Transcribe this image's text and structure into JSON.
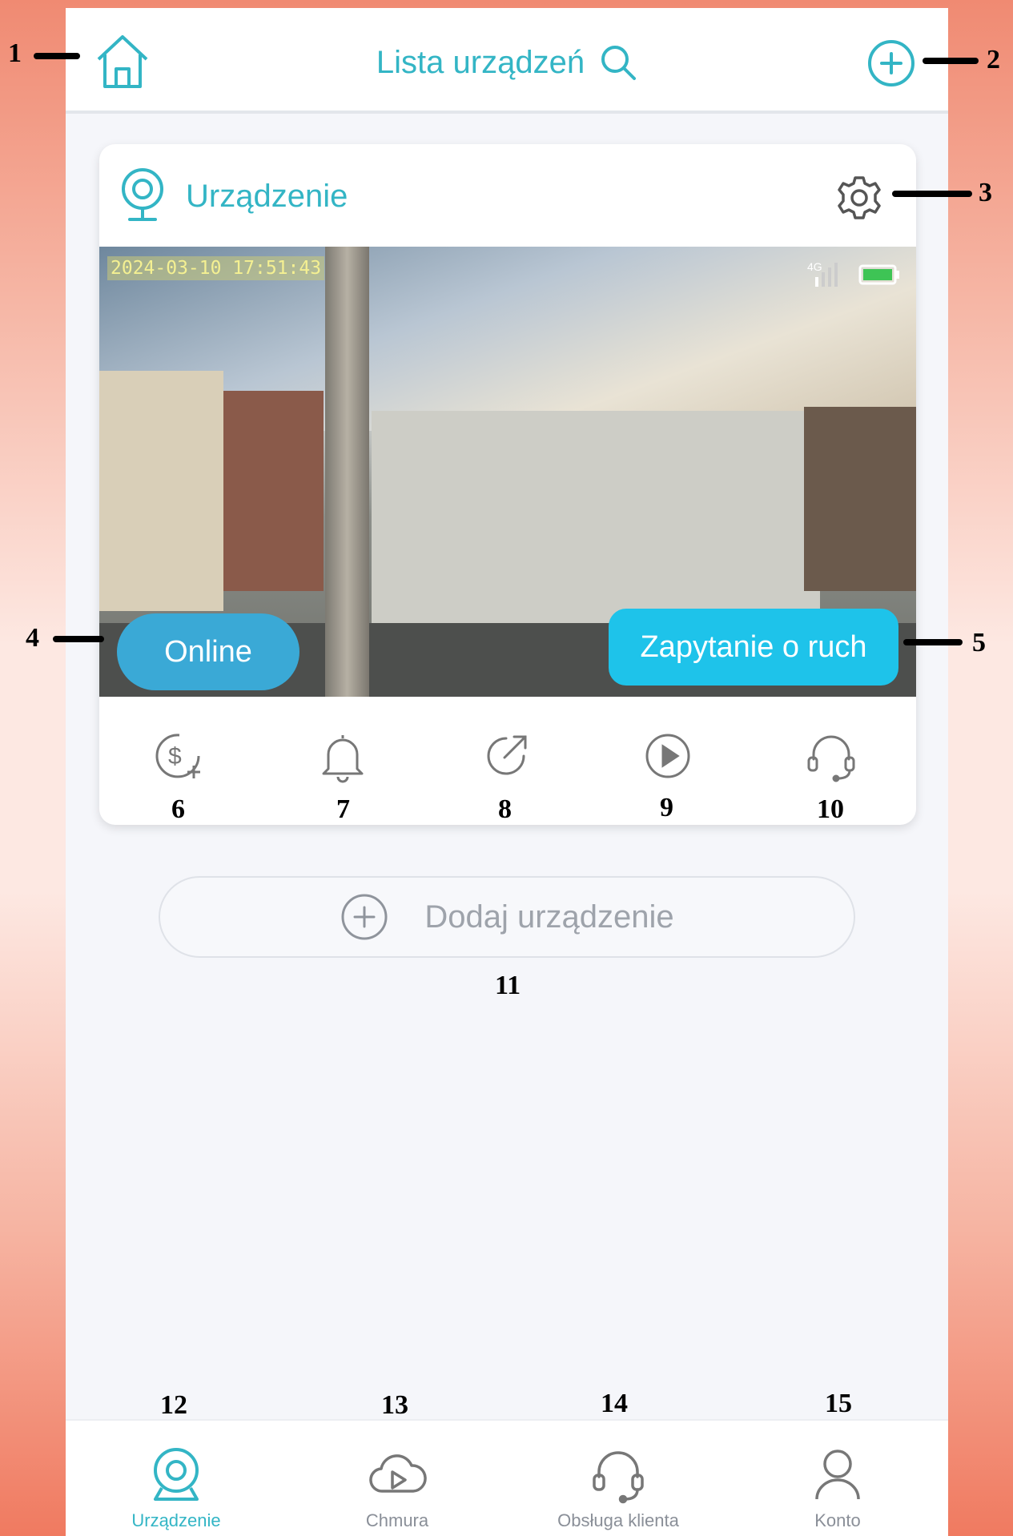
{
  "header": {
    "title": "Lista urządzeń",
    "home_icon": "home-icon",
    "search_icon": "search-icon",
    "add_icon": "plus-circle-icon"
  },
  "device_card": {
    "name": "Urządzenie",
    "camera_icon": "camera-icon",
    "settings_icon": "gear-icon",
    "preview": {
      "timestamp": "2024-03-10  17:51:43",
      "network": "4G",
      "battery_icon": "battery-icon"
    },
    "status_label": "Online",
    "motion_button_label": "Zapytanie o ruch",
    "actions": [
      {
        "icon": "dollar-plus-icon"
      },
      {
        "icon": "bell-icon"
      },
      {
        "icon": "share-icon"
      },
      {
        "icon": "play-icon"
      },
      {
        "icon": "headset-icon"
      }
    ]
  },
  "add_device": {
    "label": "Dodaj urządzenie",
    "icon": "plus-circle-icon"
  },
  "tabbar": {
    "tabs": [
      {
        "label": "Urządzenie",
        "icon": "camera-icon",
        "active": true
      },
      {
        "label": "Chmura",
        "icon": "cloud-play-icon",
        "active": false
      },
      {
        "label": "Obsługa klienta",
        "icon": "headset-icon",
        "active": false
      },
      {
        "label": "Konto",
        "icon": "user-icon",
        "active": false
      }
    ]
  },
  "callouts": [
    "1",
    "2",
    "3",
    "4",
    "5",
    "6",
    "7",
    "8",
    "9",
    "10",
    "11",
    "12",
    "13",
    "14",
    "15"
  ],
  "colors": {
    "accent": "#33b5c5",
    "online_badge": "#3aa9d6",
    "motion_button": "#1ec3ea",
    "icon_gray": "#8a8f98"
  }
}
